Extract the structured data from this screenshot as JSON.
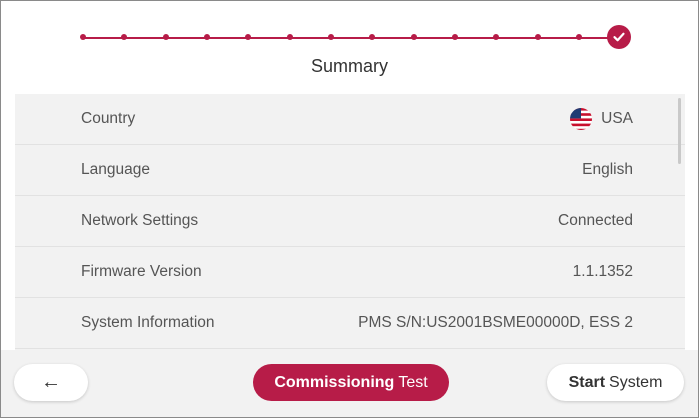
{
  "header": {
    "title": "Summary",
    "steps_total": 14,
    "steps_completed": 14
  },
  "summary": {
    "rows": [
      {
        "label": "Country",
        "value": "USA",
        "icon": "us-flag-icon"
      },
      {
        "label": "Language",
        "value": "English"
      },
      {
        "label": "Network Settings",
        "value": "Connected"
      },
      {
        "label": "Firmware Version",
        "value": "1.1.1352"
      },
      {
        "label": "System Information",
        "value": "PMS S/N:US2001BSME00000D, ESS 2"
      }
    ]
  },
  "footer": {
    "back_label": "←",
    "commission_bold": "Commissioning",
    "commission_rest": "Test",
    "start_bold": "Start",
    "start_rest": "System"
  },
  "colors": {
    "accent": "#b71c48",
    "panel": "#f2f2f2"
  }
}
